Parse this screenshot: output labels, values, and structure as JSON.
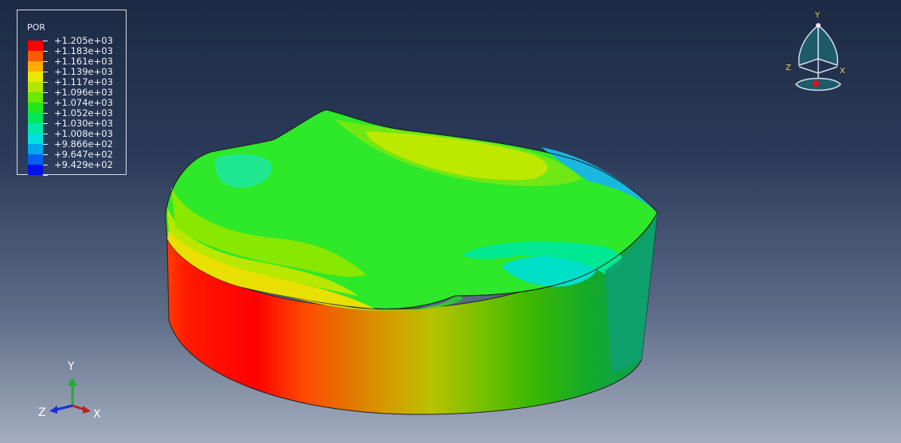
{
  "legend": {
    "title": "POR",
    "entries": [
      {
        "label": "+1.205e+03",
        "color": "#ff0000"
      },
      {
        "label": "+1.183e+03",
        "color": "#ff5a00"
      },
      {
        "label": "+1.161e+03",
        "color": "#ffab00"
      },
      {
        "label": "+1.139e+03",
        "color": "#e8e800"
      },
      {
        "label": "+1.117e+03",
        "color": "#b0e800"
      },
      {
        "label": "+1.096e+03",
        "color": "#6ae800"
      },
      {
        "label": "+1.074e+03",
        "color": "#20e81c"
      },
      {
        "label": "+1.052e+03",
        "color": "#00e85a"
      },
      {
        "label": "+1.030e+03",
        "color": "#00e8a8"
      },
      {
        "label": "+1.008e+03",
        "color": "#00e0e0"
      },
      {
        "label": "+9.866e+02",
        "color": "#00a8f0"
      },
      {
        "label": "+9.647e+02",
        "color": "#0060f0"
      },
      {
        "label": "+9.429e+02",
        "color": "#0010f0"
      }
    ]
  },
  "triad": {
    "x": "X",
    "y": "Y",
    "z": "Z"
  },
  "view_cube": {
    "x": "X",
    "y": "Y",
    "z": "Z"
  }
}
